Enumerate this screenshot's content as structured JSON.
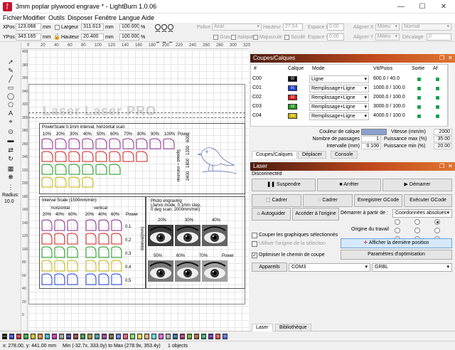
{
  "window": {
    "title": "3mm poplar plywood engrave * - LightBurn 1.0.06",
    "controls": [
      "—",
      "☐",
      "✕"
    ]
  },
  "menu": [
    "Fichier",
    "Modifier",
    "Outils",
    "Disposer",
    "Fenêtre",
    "Langue",
    "Aide"
  ],
  "toolbar": {
    "xpos_label": "XPos",
    "xpos_value": "123.068",
    "xpos_unit": "mm",
    "ypos_label": "YPos",
    "ypos_value": "343.165",
    "ypos_unit": "mm",
    "width_label": "Largeur",
    "width_value": "311.613",
    "width_unit": "mm",
    "height_label": "Hauteur",
    "height_value": "20.400",
    "height_unit": "mm",
    "scale_w": "100.000",
    "scale_h": "100.000",
    "pct": "%",
    "font_label": "Police",
    "font_value": "Arial",
    "text_height_label": "Hauteur",
    "text_height_value": "27.54",
    "hspace_label": "Espace H",
    "hspace_value": "0.00",
    "vspace_label": "Espace V",
    "vspace_value": "0.00",
    "alignx_label": "Aligner X",
    "alignx_value": "Milieu",
    "aligny_label": "Aligner Y",
    "aligny_value": "Milieu",
    "style_label": "Normal",
    "offset_label": "Décalage",
    "offset_value": "0",
    "bold_label": "Gras",
    "italic_label": "Italique",
    "upper_label": "Majuscule",
    "weld_label": "Soudé"
  },
  "left_tools": {
    "radius_label": "Radius:",
    "radius_value": "10.0"
  },
  "canvas": {
    "ruler_top": [
      "0",
      "20",
      "40",
      "60",
      "80",
      "100",
      "120",
      "140",
      "160",
      "180",
      "200",
      "220",
      "240",
      "260",
      "280",
      "300",
      "320"
    ],
    "ruler_left": [
      "400",
      "380",
      "360",
      "340",
      "320",
      "300",
      "280",
      "260",
      "240",
      "220",
      "200",
      "180",
      "160",
      "140",
      "120",
      "100",
      "80",
      "60",
      "40",
      "20",
      "0"
    ],
    "text_header": "Laser Laser PRO",
    "power_title": "PowerScale 0.1mm interval, horizontal scan",
    "power_pcts": [
      "10%",
      "20%",
      "30%",
      "40%",
      "50%",
      "60%",
      "70%",
      "80%",
      "90%",
      "100%",
      "Power"
    ],
    "speed_label": "Speed – mm/min",
    "speeds": [
      "600",
      "1200",
      "1800",
      "2400"
    ],
    "interval_title": "Interval Scale (1500mm/min)",
    "horizontal": "horizontal",
    "vertical": "vertical",
    "interval_pcts": [
      "20%",
      "40%",
      "60%",
      "20%",
      "40%",
      "60%",
      "Power"
    ],
    "intervals": [
      "0.1",
      "0.2",
      "0.3",
      "0.4",
      "0.5"
    ],
    "interval_axis": "Interval(mm)",
    "photo_title": "Photo engraving",
    "photo_sub1": "(Jarvis mode, 0.1mm step,",
    "photo_sub2": "0 deg scan, 2000mm/min)",
    "photo_top_pcts": [
      "20%",
      "30%",
      "40%"
    ],
    "photo_bottom_pcts": [
      "50%",
      "60%",
      "70%",
      "Power"
    ]
  },
  "palette": {
    "swatches": [
      {
        "label": "00",
        "color": "#000000"
      },
      {
        "label": "01",
        "color": "#1f3fd6"
      },
      {
        "label": "02",
        "color": "#d21a1a"
      },
      {
        "label": "03",
        "color": "#1a9a1a"
      },
      {
        "label": "04",
        "color": "#c8b400"
      },
      {
        "label": "05",
        "color": "#d6781a"
      },
      {
        "label": "06",
        "color": "#16a8c8"
      },
      {
        "label": "07",
        "color": "#c81aa8"
      },
      {
        "label": "08",
        "color": "#8a8a8a"
      },
      {
        "label": "09",
        "color": "#2a2a8a"
      },
      {
        "label": "10",
        "color": "#8a2a2a"
      },
      {
        "label": "11",
        "color": "#2a8a2a"
      },
      {
        "label": "12",
        "color": "#8a8a2a"
      },
      {
        "label": "13",
        "color": "#2a8a8a"
      },
      {
        "label": "14",
        "color": "#8a2a8a"
      },
      {
        "label": "15",
        "color": "#6a4a2a"
      },
      {
        "label": "16",
        "color": "#4a6ad6"
      },
      {
        "label": "17",
        "color": "#d64a6a"
      },
      {
        "label": "18",
        "color": "#6ad64a"
      },
      {
        "label": "19",
        "color": "#d6d64a"
      },
      {
        "label": "20",
        "color": "#d6a44a"
      },
      {
        "label": "21",
        "color": "#4ad6d6"
      },
      {
        "label": "22",
        "color": "#d64ad6"
      },
      {
        "label": "23",
        "color": "#a4a4a4"
      },
      {
        "label": "24",
        "color": "#1a5a9a"
      },
      {
        "label": "25",
        "color": "#9a1a5a"
      },
      {
        "label": "26",
        "color": "#5a9a1a"
      },
      {
        "label": "27",
        "color": "#9a5a1a"
      },
      {
        "label": "28",
        "color": "#1a9a5a"
      },
      {
        "label": "29",
        "color": "#5a1a9a"
      },
      {
        "label": "T1",
        "color": "#e04040"
      },
      {
        "label": "T2",
        "color": "#4060e0"
      }
    ]
  },
  "status": {
    "pos": "x: 278.00, y: 441.00 mm",
    "bounds": "Min (-32.7x, 333.0y) to Max (278.9x, 353.4y)",
    "objects": "1 objects"
  },
  "layers_panel": {
    "title": "Coupes/Calques",
    "headers": [
      "#",
      "Calque",
      "Mode",
      "Vit/Puiss",
      "Sortie",
      "Af"
    ],
    "rows": [
      {
        "id": "C00",
        "swatch": "00",
        "color": "#000000",
        "mode": "Ligne",
        "speed": "600.0 / 40.0"
      },
      {
        "id": "C01",
        "swatch": "01",
        "color": "#1f3fd6",
        "mode": "Remplissage+Ligne",
        "speed": "1000.0 / 100.0"
      },
      {
        "id": "C02",
        "swatch": "02",
        "color": "#d21a1a",
        "mode": "Remplissage+Ligne",
        "speed": "2000.0 / 100.0"
      },
      {
        "id": "C03",
        "swatch": "03",
        "color": "#1a9a1a",
        "mode": "Remplissage+Ligne",
        "speed": "3000.0 / 100.0"
      },
      {
        "id": "C04",
        "swatch": "04",
        "color": "#c8b400",
        "mode": "Remplissage+Ligne",
        "speed": "4000.0 / 100.0"
      }
    ],
    "layer_color_label": "Couleur de calque",
    "speed_label": "Vitesse (mm/m)",
    "speed_value": "2000",
    "passes_label": "Nombre de passages",
    "passes_value": "1",
    "pmax_label": "Puissance max (%)",
    "pmax_value": "35.00",
    "interval_label": "Intervalle (mm)",
    "interval_value": "0.100",
    "pmin_label": "Puissance min (%)",
    "pmin_value": "20.00",
    "tabs": [
      "Coupes/Calques",
      "Déplacer",
      "Console"
    ]
  },
  "laser_panel": {
    "title": "Laser",
    "status": "Disconnected",
    "pause": "Suspendre",
    "stop": "Arrêter",
    "start": "Démarrer",
    "frame": "Cadrer",
    "frame2": "Cadrer",
    "save_gcode": "Enregistrer GCode",
    "run_gcode": "Exécuter GCode",
    "home": "Autoguider",
    "goto_origin": "Accéder à l'origine",
    "start_from_label": "Démarrer à partir de :",
    "start_from_value": "Coordonnées absolues",
    "cut_selected": "Couper les graphiques sélectionnés",
    "use_origin": "Utiliser l'origine de la sélection",
    "optimize": "Optimiser le chemin de coupe",
    "job_origin": "Origine du travail",
    "show_last": "Afficher la dernière position",
    "opt_settings": "Paramètres d'optimisation",
    "devices": "Appareils",
    "port": "COM3",
    "controller": "GRBL",
    "tabs": [
      "Laser",
      "Bibliothèque"
    ]
  },
  "colors": {
    "panel_gradient_start": "#4a1c10",
    "panel_gradient_end": "#e0742f",
    "active_green": "#1aa34a",
    "layer_color_chip": "#8aa0d0"
  }
}
